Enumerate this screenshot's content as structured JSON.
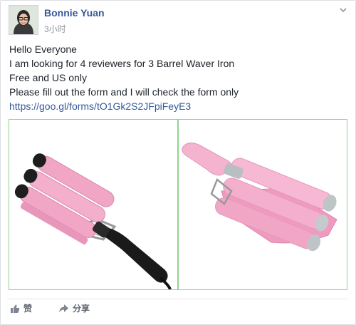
{
  "post": {
    "author": "Bonnie Yuan",
    "timestamp": "3小时",
    "lines": [
      "Hello Everyone",
      "I am looking for 4 reviewers for 3 Barrel Waver Iron",
      "Free and US only",
      "Please fill out the form and I will check the form only"
    ],
    "link": "https://goo.gl/forms/tO1Gk2S2JFpiFeyE3"
  },
  "actions": {
    "like_label": "赞",
    "share_label": "分享"
  },
  "colors": {
    "link": "#365899",
    "photo_border": "#8fd48a",
    "barrel_pink": "#f2a6c6"
  },
  "icons": [
    "chevron-down-icon",
    "thumbs-up-icon",
    "share-arrow-icon"
  ]
}
